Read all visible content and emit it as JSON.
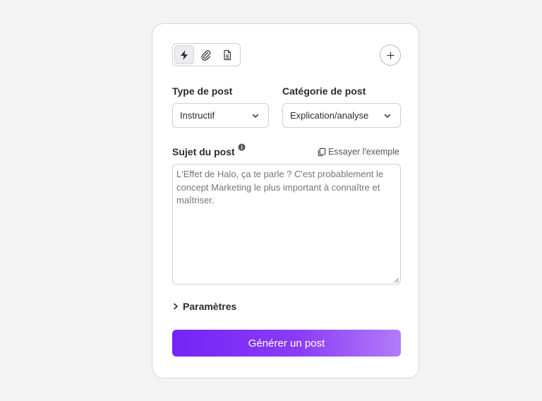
{
  "toolbar": {
    "modes": [
      {
        "icon": "lightning-icon",
        "active": true
      },
      {
        "icon": "paperclip-icon",
        "active": false
      },
      {
        "icon": "document-icon",
        "active": false
      }
    ],
    "add_icon": "plus-icon"
  },
  "form": {
    "post_type": {
      "label": "Type de post",
      "value": "Instructif"
    },
    "post_category": {
      "label": "Catégorie de post",
      "value": "Explication/analyse"
    },
    "subject": {
      "label": "Sujet du post",
      "example_link": "Essayer l'exemple",
      "placeholder": "L'Effet de Halo, ça te parle ? C'est probablement le concept Marketing le plus important à connaître et maîtriser."
    },
    "params_label": "Paramètres",
    "generate_label": "Générer un post"
  },
  "colors": {
    "accent_start": "#7424f5",
    "accent_end": "#b27cf8"
  }
}
